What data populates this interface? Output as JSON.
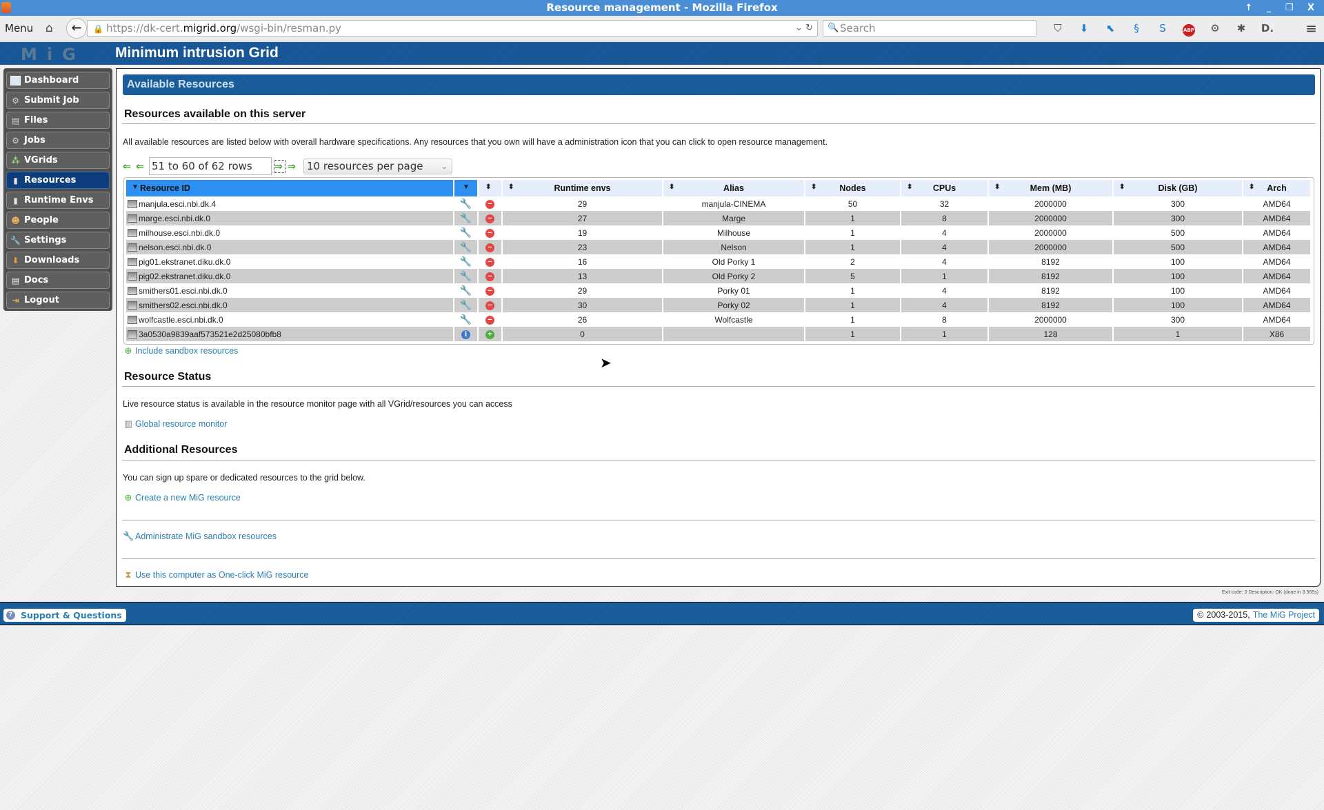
{
  "window": {
    "title": "Resource management - Mozilla Firefox",
    "controls": "↑ _ ❐ X"
  },
  "browser": {
    "menu_label": "Menu",
    "url_scheme": "https://dk-cert.",
    "url_host": "migrid.org",
    "url_path": "/wsgi-bin/resman.py",
    "search_placeholder": "Search",
    "toolbar_icons": [
      "pocket-icon",
      "download-icon",
      "cursor-tool-icon",
      "addon-icon",
      "s-addon-icon",
      "adblock-plus-icon",
      "settings-gear-icon",
      "extension-icon",
      "d-addon-icon"
    ]
  },
  "header": {
    "logo": "MiG",
    "title": "Minimum intrusion Grid"
  },
  "sidebar": {
    "items": [
      {
        "label": "Dashboard",
        "icon": "dashboard-icon",
        "active": false
      },
      {
        "label": "Submit Job",
        "icon": "submit-job-icon",
        "active": false
      },
      {
        "label": "Files",
        "icon": "files-icon",
        "active": false
      },
      {
        "label": "Jobs",
        "icon": "jobs-gear-icon",
        "active": false
      },
      {
        "label": "VGrids",
        "icon": "vgrids-icon",
        "active": false
      },
      {
        "label": "Resources",
        "icon": "resources-server-icon",
        "active": true
      },
      {
        "label": "Runtime Envs",
        "icon": "runtime-envs-icon",
        "active": false
      },
      {
        "label": "People",
        "icon": "people-icon",
        "active": false
      },
      {
        "label": "Settings",
        "icon": "settings-wrench-icon",
        "active": false
      },
      {
        "label": "Downloads",
        "icon": "downloads-icon",
        "active": false
      },
      {
        "label": "Docs",
        "icon": "docs-icon",
        "active": false
      },
      {
        "label": "Logout",
        "icon": "logout-icon",
        "active": false
      }
    ]
  },
  "main": {
    "banner": "Available Resources",
    "section1": {
      "heading": "Resources available on this server",
      "description": "All available resources are listed below with overall hardware specifications. Any resources that you own will have a administration icon that you can click to open resource management."
    },
    "pager": {
      "range_text": "51 to 60 of 62 rows",
      "per_page": "10 resources per page"
    },
    "table": {
      "headers": [
        "Resource ID",
        "",
        "",
        "Runtime envs",
        "Alias",
        "Nodes",
        "CPUs",
        "Mem (MB)",
        "Disk (GB)",
        "Arch"
      ],
      "rows": [
        {
          "id": "manjula.esci.nbi.dk.4",
          "action": "admin",
          "status": "remove",
          "runtime_envs": "29",
          "alias": "manjula-CINEMA",
          "nodes": "50",
          "cpus": "32",
          "mem": "2000000",
          "disk": "300",
          "arch": "AMD64"
        },
        {
          "id": "marge.esci.nbi.dk.0",
          "action": "admin",
          "status": "remove",
          "runtime_envs": "27",
          "alias": "Marge",
          "nodes": "1",
          "cpus": "8",
          "mem": "2000000",
          "disk": "300",
          "arch": "AMD64"
        },
        {
          "id": "milhouse.esci.nbi.dk.0",
          "action": "admin",
          "status": "remove",
          "runtime_envs": "19",
          "alias": "Milhouse",
          "nodes": "1",
          "cpus": "4",
          "mem": "2000000",
          "disk": "500",
          "arch": "AMD64"
        },
        {
          "id": "nelson.esci.nbi.dk.0",
          "action": "admin",
          "status": "remove",
          "runtime_envs": "23",
          "alias": "Nelson",
          "nodes": "1",
          "cpus": "4",
          "mem": "2000000",
          "disk": "500",
          "arch": "AMD64"
        },
        {
          "id": "pig01.ekstranet.diku.dk.0",
          "action": "admin",
          "status": "remove",
          "runtime_envs": "16",
          "alias": "Old Porky 1",
          "nodes": "2",
          "cpus": "4",
          "mem": "8192",
          "disk": "100",
          "arch": "AMD64"
        },
        {
          "id": "pig02.ekstranet.diku.dk.0",
          "action": "admin",
          "status": "remove",
          "runtime_envs": "13",
          "alias": "Old Porky 2",
          "nodes": "5",
          "cpus": "1",
          "mem": "8192",
          "disk": "100",
          "arch": "AMD64"
        },
        {
          "id": "smithers01.esci.nbi.dk.0",
          "action": "admin",
          "status": "remove",
          "runtime_envs": "29",
          "alias": "Porky 01",
          "nodes": "1",
          "cpus": "4",
          "mem": "8192",
          "disk": "100",
          "arch": "AMD64"
        },
        {
          "id": "smithers02.esci.nbi.dk.0",
          "action": "admin",
          "status": "remove",
          "runtime_envs": "30",
          "alias": "Porky 02",
          "nodes": "1",
          "cpus": "4",
          "mem": "8192",
          "disk": "100",
          "arch": "AMD64"
        },
        {
          "id": "wolfcastle.esci.nbi.dk.0",
          "action": "admin",
          "status": "remove",
          "runtime_envs": "26",
          "alias": "Wolfcastle",
          "nodes": "1",
          "cpus": "8",
          "mem": "2000000",
          "disk": "300",
          "arch": "AMD64"
        },
        {
          "id": "3a0530a9839aaf573521e2d25080bfb8",
          "action": "info",
          "status": "add",
          "runtime_envs": "0",
          "alias": "",
          "nodes": "1",
          "cpus": "1",
          "mem": "128",
          "disk": "1",
          "arch": "X86"
        }
      ]
    },
    "include_sandbox_link": "Include sandbox resources",
    "section2": {
      "heading": "Resource Status",
      "description": "Live resource status is available in the resource monitor page with all VGrid/resources you can access",
      "monitor_link": "Global resource monitor"
    },
    "section3": {
      "heading": "Additional Resources",
      "description": "You can sign up spare or dedicated resources to the grid below.",
      "create_link": "Create a new MiG resource",
      "sandbox_admin_link": "Administrate MiG sandbox resources",
      "oneclick_link": "Use this computer as One-click MiG resource"
    },
    "exit_code": "Exit code: 0 Description: OK (done in 3.565s)"
  },
  "footer": {
    "support": "Support & Questions",
    "copyright": "2003-2015,",
    "project": "The MiG Project"
  }
}
